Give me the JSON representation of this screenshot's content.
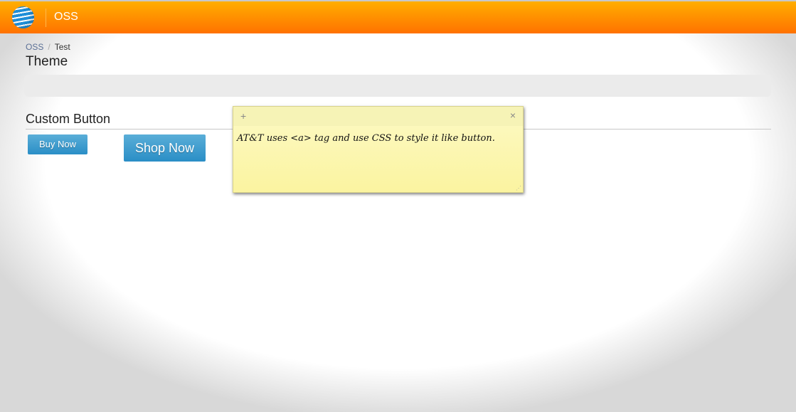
{
  "header": {
    "app_name": "OSS"
  },
  "breadcrumb": {
    "items": [
      "OSS",
      "Test"
    ],
    "separator": "/"
  },
  "page": {
    "title": "Theme",
    "section_title": "Custom Button"
  },
  "buttons": {
    "buy_now": "Buy Now",
    "shop_now": "Shop Now"
  },
  "note": {
    "add": "+",
    "close": "×",
    "text": "AT&T uses <a> tag and use CSS to style it like button."
  },
  "colors": {
    "header_top": "#ffae00",
    "header_bottom": "#ff7200",
    "button": "#2a8ec6",
    "note": "#fbf4a0"
  }
}
